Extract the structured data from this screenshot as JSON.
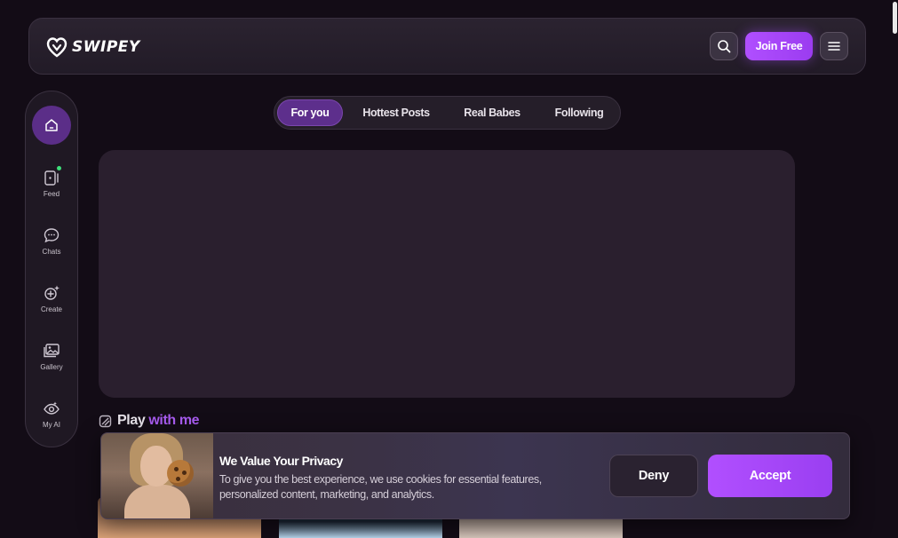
{
  "brand": {
    "name": "SWIPEY",
    "logo_icon": "heart-logo-icon"
  },
  "header": {
    "search_icon": "search-icon",
    "join_label": "Join Free",
    "menu_icon": "hamburger-menu-icon"
  },
  "sidebar": {
    "home": {
      "icon": "home-icon"
    },
    "items": [
      {
        "label": "Feed",
        "icon": "feed-icon"
      },
      {
        "label": "Chats",
        "icon": "chat-bubble-icon"
      },
      {
        "label": "Create",
        "icon": "sparkle-plus-icon"
      },
      {
        "label": "Gallery",
        "icon": "gallery-icon"
      },
      {
        "label": "My AI",
        "icon": "eye-icon"
      }
    ]
  },
  "tabs": [
    {
      "label": "For you",
      "active": true
    },
    {
      "label": "Hottest Posts",
      "active": false
    },
    {
      "label": "Real Babes",
      "active": false
    },
    {
      "label": "Following",
      "active": false
    }
  ],
  "section": {
    "title_white": "Play",
    "title_purple": "with me",
    "icon": "play-stack-icon"
  },
  "cookie": {
    "title": "We Value Your Privacy",
    "text": "To give you the best experience, we use cookies for essential features, personalized content, marketing, and analytics.",
    "deny_label": "Deny",
    "accept_label": "Accept"
  },
  "colors": {
    "accent": "#a855f7",
    "background": "#130c16",
    "active_tab": "#5d2f8c"
  }
}
